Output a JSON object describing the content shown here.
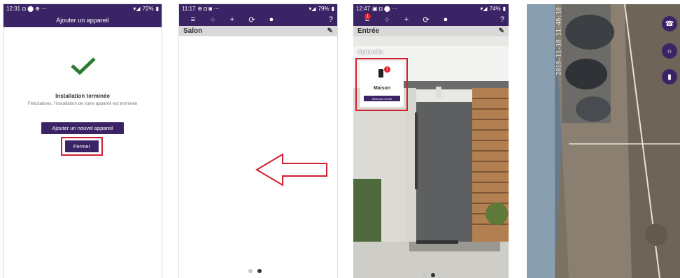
{
  "screen1": {
    "status": {
      "time": "12:31",
      "icons_left": "◘ ⬤ ⊕ ···",
      "battery": "72%"
    },
    "header_title": "Ajouter un appareil",
    "success_title": "Installation terminée",
    "success_subtitle": "Félicitations, l'installation de votre appareil est terminée",
    "add_button": "Ajouter un nouvel appareil",
    "close_button": "Fermer"
  },
  "screen2": {
    "status": {
      "time": "11:17",
      "icons_left": "⊕ ◘ ◙ ···",
      "battery": "79%"
    },
    "toolbar": {
      "menu": "≡",
      "grid": "⁘",
      "add": "+",
      "refresh": "⟳",
      "mic": "🎤",
      "help": "?"
    },
    "room_name": "Salon"
  },
  "screen3": {
    "status": {
      "time": "12:47",
      "icons_left": "▣ ◘ ⬤ ···",
      "battery": "74%"
    },
    "toolbar": {
      "menu": "≡",
      "menu_badge": "1",
      "grid": "⁘",
      "add": "+",
      "refresh": "⟳",
      "mic": "🎤",
      "help": "?"
    },
    "room_name": "Entrée",
    "section_label": "Appareils",
    "device": {
      "name": "Maison",
      "badge": "1",
      "brand": "Welcome Home"
    }
  },
  "screen4": {
    "timestamp": "2019-11-18 11:48:10"
  },
  "colors": {
    "brand": "#3b2466",
    "highlight": "#d1202f",
    "success": "#2e7d32"
  }
}
